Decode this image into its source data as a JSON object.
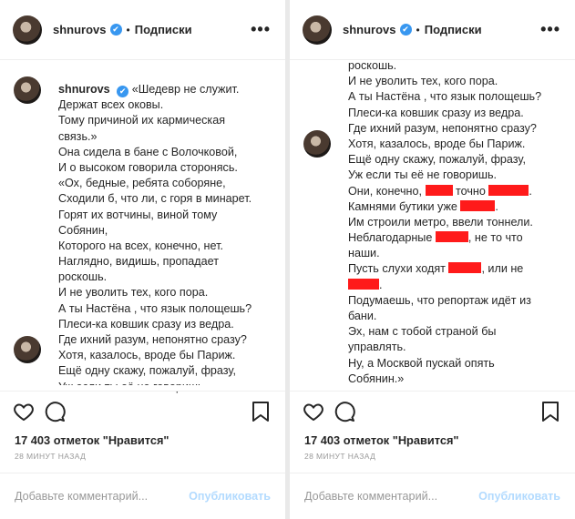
{
  "post": {
    "username": "shnurovs",
    "verified_mark": "✔",
    "separator": "•",
    "follow_label": "Подписки",
    "more_label": "•••",
    "likes": "17 403 отметок \"Нравится\"",
    "time": "28 МИНУТ НАЗАД",
    "comment_placeholder": "Добавьте комментарий...",
    "publish_label": "Опубликовать"
  },
  "left_caption": [
    "«Шедевр не служит.",
    "Держат всех оковы.",
    "Тому причиной их кармическая",
    "связь.»",
    "Она сидела в бане с Волочковой,",
    "И о высоком говорила сторонясь.",
    "«Ох, бедные, ребята соборяне,",
    "Сходили б, что ли, с горя в минарет.",
    "Горят их вотчины, виной тому",
    "Собянин,",
    "Которого на всех, конечно, нет.",
    "Наглядно, видишь, пропадает",
    "роскошь.",
    "И не уволить тех, кого пора.",
    "А ты Настёна , что язык полощешь?",
    "Плеси-ка ковшик сразу из ведра.",
    "Где ихний разум, непонятно сразу?",
    "Хотя, казалось, вроде бы Париж.",
    "Ещё одну скажу, пожалуй, фразу,",
    "Уж если ты её не говоришь"
  ],
  "right_caption": {
    "l1": "роскошь.",
    "l2": "И не уволить тех, кого пора.",
    "l3": "А ты Настёна , что язык полощешь?",
    "l4": "Плеси-ка ковшик сразу из ведра.",
    "l5": "Где ихний разум, непонятно сразу?",
    "l6": "Хотя, казалось, вроде бы Париж.",
    "l7": "Ещё одну скажу, пожалуй, фразу,",
    "l8": "Уж если ты её не говоришь.",
    "l9a": "Они, конечно,",
    "l9b": "точно",
    "l9c": ".",
    "l10a": "Камнями бутики уже",
    "l10b": ".",
    "l11": "Им строили метро, ввели тоннели.",
    "l12a": "Неблагодарные",
    "l12b": ", не то что",
    "l13": "наши.",
    "l14a": "Пусть слухи ходят",
    "l14b": ", или не",
    "l15b": ".",
    "l16": "Подумаешь, что репортаж идёт из",
    "l17": "бани.",
    "l18": "Эх, нам с тобой страной бы",
    "l19": "управлять.",
    "l20": "Ну, а Москвой пускай опять",
    "l21": "Собянин.»"
  },
  "colors": {
    "redaction": "#ff1a1a",
    "verified": "#3897f0",
    "publish": "#b3dbff"
  },
  "icons": [
    "heart-icon",
    "comment-icon",
    "bookmark-icon",
    "verified-icon"
  ]
}
